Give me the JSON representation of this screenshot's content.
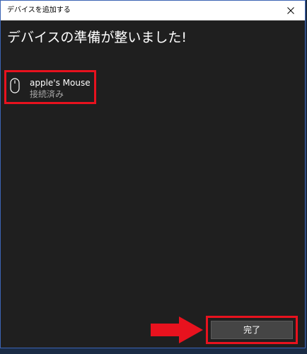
{
  "window": {
    "title": "デバイスを追加する"
  },
  "main": {
    "heading": "デバイスの準備が整いました!"
  },
  "device": {
    "name": "apple's Mouse",
    "status": "接続済み",
    "icon": "mouse-icon"
  },
  "footer": {
    "done_label": "完了"
  },
  "colors": {
    "highlight": "#e8121e",
    "window_bg": "#1f1f1f",
    "button_bg": "#454545",
    "status_text": "#a6a6a6"
  }
}
